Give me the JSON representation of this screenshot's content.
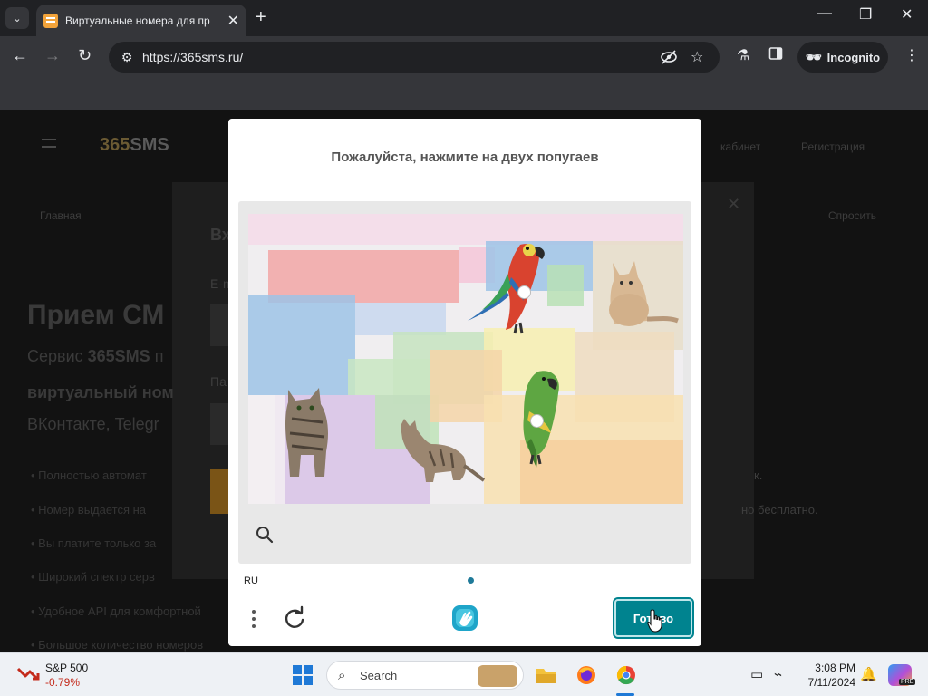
{
  "browser": {
    "tab_title": "Виртуальные номера для пр",
    "tab_close": "✕",
    "new_tab": "+",
    "url": "https://365sms.ru/",
    "incognito_label": "Incognito",
    "window_controls": [
      "minimize-icon",
      "restore-icon",
      "close-icon"
    ]
  },
  "background_page": {
    "logo_accent": "365",
    "logo_rest": "SMS",
    "nav_right_1": "кабинет",
    "nav_right_2": "Регистрация",
    "modal_left": "Главная",
    "modal_right": "Спросить",
    "modal_title_partial": "Вх",
    "email_label_partial": "E-m",
    "password_label_partial": "Па",
    "hero_title_partial": "Прием СМ",
    "hero_line1_prefix": "Сервис ",
    "hero_line1_brand": "365SMS",
    "hero_line1_rest": " п",
    "hero_line2": "виртуальный ном",
    "hero_line3": "ВКонтакте, Telegr",
    "bullets": [
      "Полностью автомат",
      "Номер выдается на",
      "Вы платите только за",
      "Широкий спектр серв",
      "Удобное API для комфортной",
      "Большое количество номеров"
    ],
    "bullet_tail_1": "к.",
    "bullet_tail_2": "но бесплатно."
  },
  "captcha": {
    "prompt": "Пожалуйста, нажмите на двух попугаев",
    "language": "RU",
    "done_label": "Готово",
    "selected_count": 2
  },
  "taskbar": {
    "stock_name": "S&P 500",
    "stock_change": "-0.79%",
    "search_placeholder": "Search",
    "time": "3:08 PM",
    "date": "7/11/2024",
    "copilot_badge": "PRE"
  },
  "colors": {
    "done_button": "#00838f",
    "page_dot": "#1f7a99",
    "stock_negative": "#c42b1c"
  }
}
